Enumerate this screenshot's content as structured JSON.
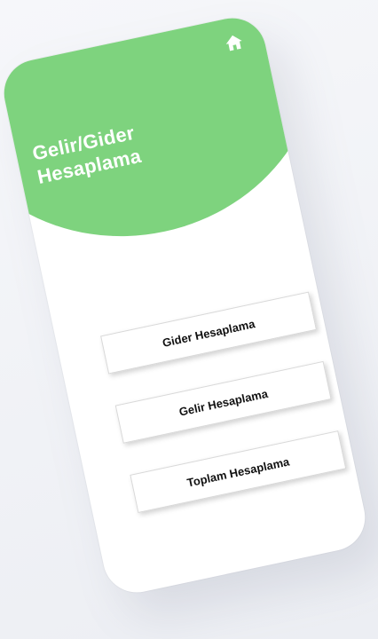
{
  "header": {
    "title_line1": "Gelir/Gider",
    "title_line2": "Hesaplama"
  },
  "menu": {
    "buttons": [
      {
        "label": "Gider Hesaplama"
      },
      {
        "label": "Gelir Hesaplama"
      },
      {
        "label": "Toplam Hesaplama"
      }
    ]
  },
  "icons": {
    "home": "home-icon"
  },
  "colors": {
    "header_green": "#7ed37e",
    "background": "#ffffff",
    "button_text": "#111111"
  }
}
